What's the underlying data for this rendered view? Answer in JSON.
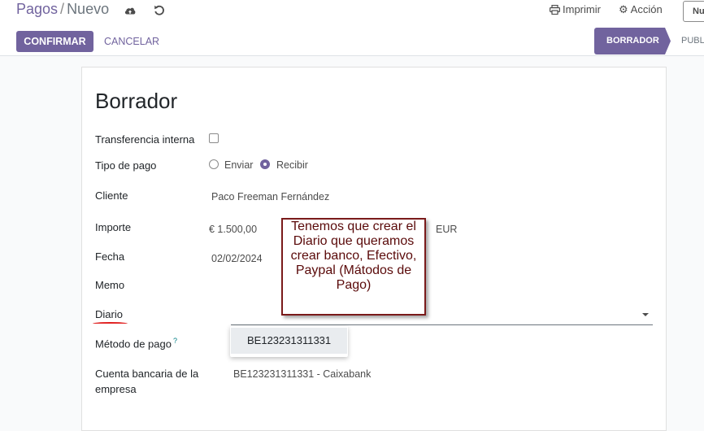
{
  "breadcrumb": {
    "parent": "Pagos",
    "separator": "/",
    "current": "Nuevo"
  },
  "top_actions": {
    "print_label": "Imprimir",
    "action_label": "Acción",
    "new_label": "Nu"
  },
  "control": {
    "confirm_label": "CONFIRMAR",
    "cancel_label": "CANCELAR"
  },
  "status": {
    "active": "BORRADOR",
    "next": "PUBLI"
  },
  "form": {
    "title": "Borrador",
    "internal_transfer_label": "Transferencia interna",
    "internal_transfer_checked": false,
    "payment_type_label": "Tipo de pago",
    "payment_type_options": [
      "Enviar",
      "Recibir"
    ],
    "payment_type_selected": "Recibir",
    "customer_label": "Cliente",
    "customer_value": "Paco Freeman Fernández",
    "amount_label": "Importe",
    "amount_value": "€ 1.500,00",
    "currency_value": "EUR",
    "date_label": "Fecha",
    "date_value": "02/02/2024",
    "memo_label": "Memo",
    "journal_label": "Diario",
    "payment_method_label": "Método de pago",
    "payment_method_help": "?",
    "bank_account_label": "Cuenta bancaria de la empresa",
    "bank_account_value": "BE123231311331 - Caixabank"
  },
  "dropdown": {
    "items": [
      "BE123231311331"
    ]
  },
  "annotation": {
    "text": "Tenemos que crear el Diario que queramos crear banco, Efectivo, Paypal (Mátodos de Pago)"
  },
  "colors": {
    "brand": "#71639e",
    "annotation_border": "#7a1a1a",
    "annotation_text": "#5a0a0a",
    "underline": "#e02020"
  },
  "icons": [
    "cloud-upload-icon",
    "discard-icon",
    "print-icon",
    "gear-icon",
    "chevron-down-icon"
  ]
}
